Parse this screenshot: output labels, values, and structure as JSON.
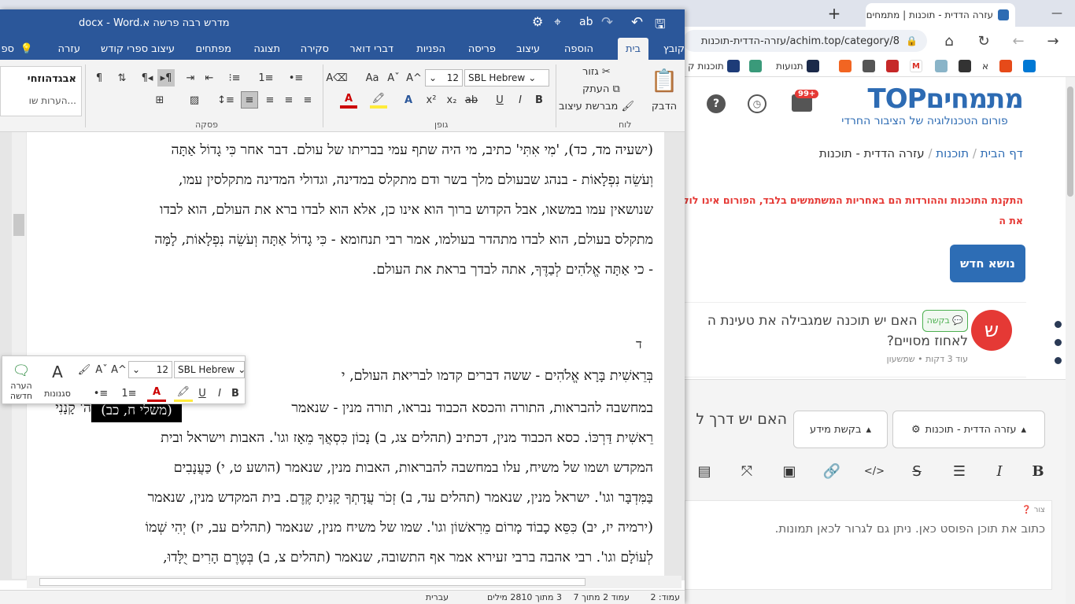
{
  "browser": {
    "tabs": [
      {
        "title": "עזרה הדדית - תוכנות | מתמחים כ"
      },
      {
        "title": ""
      }
    ],
    "new_tab": "+",
    "window_min": "—",
    "url": "achim.top/category/8/עזרה-הדדית-תוכנות",
    "bookmarks": [
      {
        "label": "תוכנות ק"
      },
      {
        "label": ""
      },
      {
        "label": "תנועות"
      },
      {
        "label": ""
      },
      {
        "label": ""
      },
      {
        "label": ""
      },
      {
        "label": ""
      },
      {
        "label": "M"
      },
      {
        "label": ""
      },
      {
        "label": "א"
      },
      {
        "label": ""
      },
      {
        "label": ""
      }
    ]
  },
  "forum": {
    "logo_main": "מתמחיםTOP",
    "logo_sub": "פורום הטכנולוגיה של הציבור החרדי",
    "notif_count": "99+",
    "breadcrumb": [
      "דף הבית",
      "תוכנות",
      "עזרה הדדית - תוכנות"
    ],
    "warning_line1": "התקנת התוכנות וההורדות הם באחריות המשתמשים בלבד, הפורום אינו לוקח",
    "warning_line2": "את ה",
    "new_topic": "נושא חדש",
    "post": {
      "avatar_letter": "ש",
      "badge": "בקשה",
      "title": "האם יש תוכנה שמגבילה את טעינת ה",
      "title2": "לאחוז מסויים?",
      "meta": "עוד 3 דקות • שמשעון"
    },
    "editor": {
      "title": "האם יש דרך ל",
      "category": "עזרה הדדית - תוכנות",
      "tag": "בקשת מידע",
      "label": "צור",
      "placeholder": "כתוב את תוכן הפוסט כאן. ניתן גם לגרור לכאן תמונות."
    }
  },
  "word": {
    "title": "מדרש רבה פרשה א.docx  -  Word",
    "tabs": [
      "קובץ",
      "בית",
      "הוספה",
      "עיצוב",
      "פריסה",
      "הפניות",
      "דברי דואר",
      "סקירה",
      "תצוגה",
      "מפתחים",
      "עיצוב ספרי קודש",
      "עזרה"
    ],
    "active_tab": "בית",
    "partial_tab": "ספ",
    "ribbon": {
      "paste": "הדבק",
      "cut": "גזור",
      "copy": "העתק",
      "format_painter": "מברשת עיצוב",
      "clipboard_group": "לוח",
      "font_group": "גופן",
      "paragraph_group": "פסקה",
      "font_name": "SBL Hebrew",
      "font_size": "12",
      "style1": "אבגדהוזחי",
      "style2": "הערות שו...",
      "style3": "כות"
    },
    "doc_lines": [
      "(ישעיה מד, כד), 'מִי אִתִּי' כתיב, מי היה שתף עמי בבריתו של עולם. דבר אחר כִּי גָדוֹל אַתָּה",
      "וְעֹשֵׂה נִפְלָאוֹת - בנהג שבעולם מלך בשר ודם מתקלס במדינה, וגדולי המדינה מתקלסין עמו,",
      "שנושאין עמו במשאו, אבל הקדוש ברוך הוא אינו כן, אלא הוא לבדו ברא את העולם, הוא לבדו",
      "מתקלס בעולם, הוא לבדו מתהדר בעולמו, אמר רבי תנחומא - כִּי גָדוֹל אַתָּה וְעֹשֵׂה נִפְלָאוֹת, לָמָּה",
      "- כי אַתָּה אֱלֹהִים לְבַדֶּךָ, אתה לבדך בראת את העולם."
    ],
    "section_letter": "ד",
    "doc_lines2": [
      "בְּרֵאשִׁית בָּרָא אֱלֹהִים - ששה דברים קדמו לבריאת העולם, י",
      "במחשבה להבראות, התורה והכסא הכבוד נבראו, תורה מנין - שנאמר",
      "רֵאשִׁית דַּרְכּוֹ. כסא הכבוד מנין, דכתיב (תהלים צג, ב) נָכוֹן כִּסְאֲךָ מֵאָז וגו'. האבות וישראל ובית",
      "המקדש ושמו של משיח, עלו במחשבה להבראות, האבות מנין, שנאמר (הושע ט, י) כַּעֲנָבִים",
      "בַּמִּדְבָּר וגו'. ישראל מנין, שנאמר (תהלים עד, ב) זְכֹר עֲדָתְךָ קָנִיתָ קֶּדֶם. בית המקדש מנין, שנאמר",
      "(ירמיה יז, יב) כִּסֵּא כָבוֹד מָרוֹם מֵרִאשׁוֹן וגו'. שמו של משיח מנין, שנאמר (תהלים עב, יז) יְהִי שְׁמוֹ",
      "לְעוֹלָם וגו'. רבי אהבה ברבי זעירא אמר אף התשובה, שנאמר (תהלים צ, ב) בְּטֶרֶם הָרִים יֻלָּדוּ,"
    ],
    "line7_suffix": "ה' קָנָנִי",
    "selected_text": "(משלי ח, כב)",
    "mini_toolbar": {
      "font": "SBL Hebrew",
      "size": "12",
      "styles": "סגנונות",
      "new_comment": "הערה חדשה"
    },
    "status": {
      "page": "עמוד: 2",
      "section": "עמוד 2 מתוך 7",
      "words": "3 מתוך 2810 מילים",
      "lang": "עברית"
    }
  }
}
